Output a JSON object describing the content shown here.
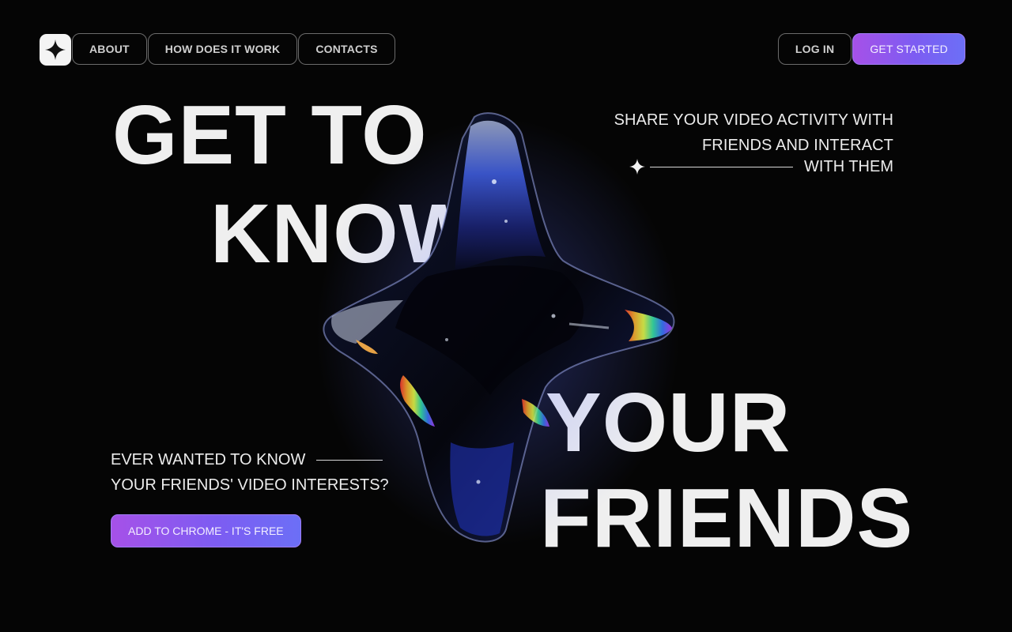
{
  "nav": {
    "logo_icon": "sparkle-star-icon",
    "about_label": "ABOUT",
    "how_label": "HOW DOES IT WORK",
    "contacts_label": "CONTACTS",
    "login_label": "LOG IN",
    "get_started_label": "GET STARTED"
  },
  "hero": {
    "line1": "GET TO",
    "line2": "KNOW",
    "line3": "YOUR",
    "line4": "FRIENDS",
    "tagline_line1": "SHARE YOUR VIDEO ACTIVITY WITH",
    "tagline_line2": "FRIENDS AND INTERACT",
    "tagline_line3": "WITH THEM",
    "question_line1": "EVER WANTED TO KNOW",
    "question_line2": "YOUR FRIENDS' VIDEO INTERESTS?",
    "cta_label": "ADD TO CHROME - IT'S FREE",
    "decor_icon": "sparkle-star-icon",
    "hero_image": "iridescent-glass-star"
  },
  "colors": {
    "background": "#050505",
    "text": "#efefef",
    "accent_gradient_start": "#a651e8",
    "accent_gradient_end": "#6c6ff6"
  }
}
